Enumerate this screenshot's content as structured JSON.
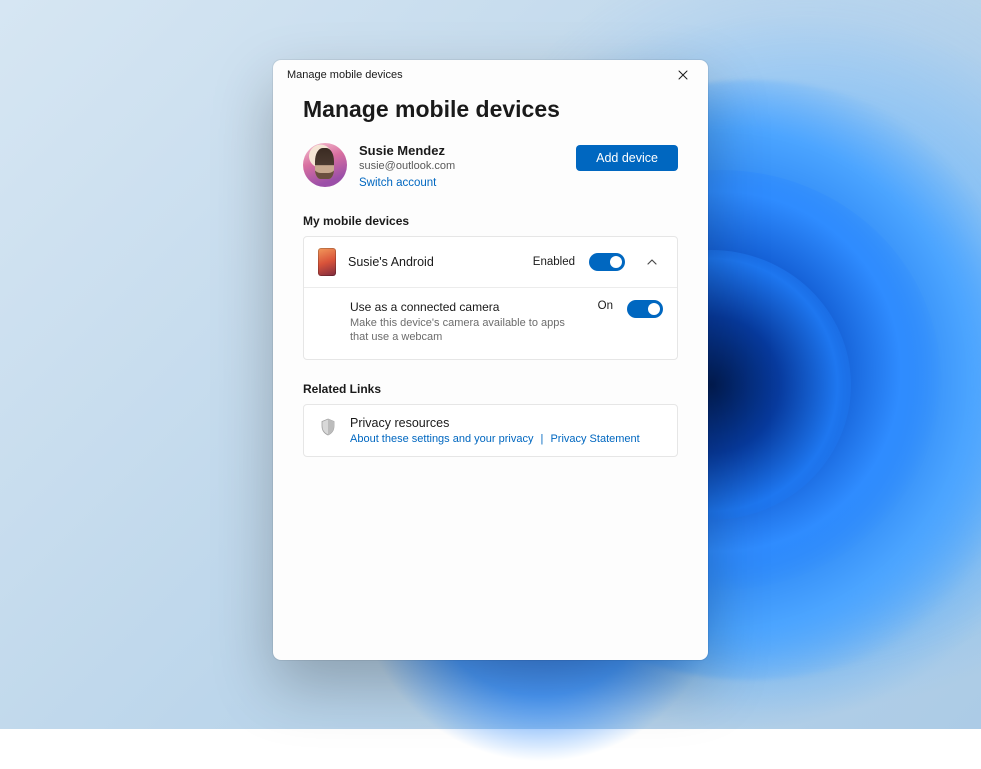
{
  "window": {
    "title": "Manage mobile devices"
  },
  "page": {
    "heading": "Manage mobile devices"
  },
  "account": {
    "name": "Susie Mendez",
    "email": "susie@outlook.com",
    "switch_label": "Switch account",
    "add_device_label": "Add device"
  },
  "sections": {
    "devices_label": "My mobile devices",
    "related_label": "Related Links"
  },
  "device": {
    "name": "Susie's Android",
    "status_label": "Enabled",
    "camera": {
      "title": "Use as a connected camera",
      "desc": "Make this device's camera available to apps that use a webcam",
      "status_label": "On"
    }
  },
  "related": {
    "title": "Privacy resources",
    "link1": "About these settings and your privacy",
    "sep": "|",
    "link2": "Privacy Statement"
  }
}
